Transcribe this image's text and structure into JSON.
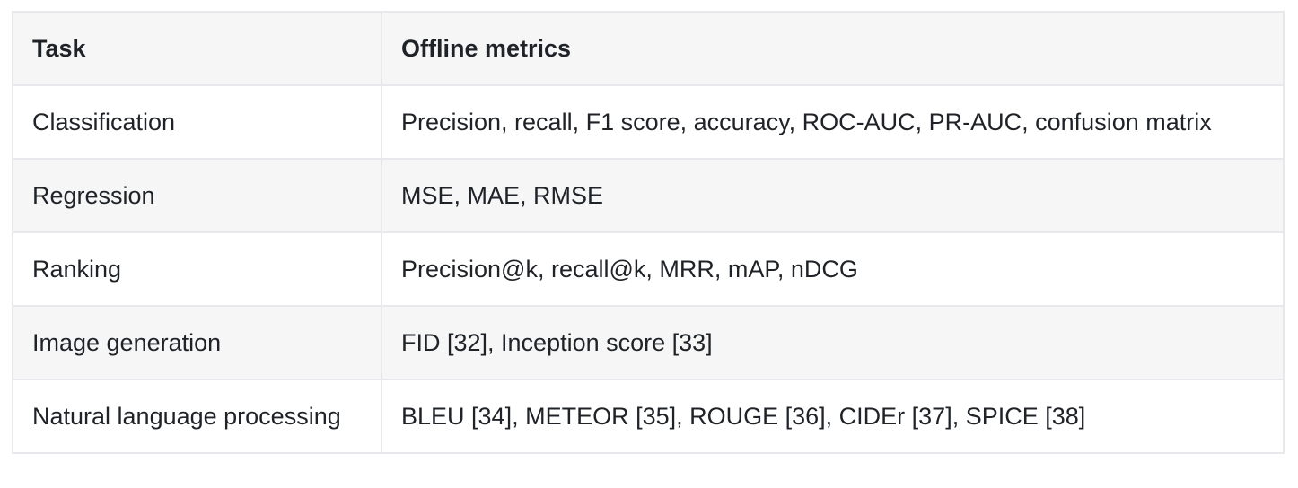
{
  "table": {
    "headers": [
      "Task",
      "Offline metrics"
    ],
    "rows": [
      [
        "Classification",
        "Precision, recall, F1 score, accuracy, ROC-AUC, PR-AUC, confusion matrix"
      ],
      [
        "Regression",
        "MSE, MAE, RMSE"
      ],
      [
        "Ranking",
        "Precision@k, recall@k, MRR, mAP, nDCG"
      ],
      [
        "Image generation",
        "FID [32], Inception score [33]"
      ],
      [
        "Natural language processing",
        "BLEU [34], METEOR [35], ROUGE [36], CIDEr [37], SPICE [38]"
      ]
    ]
  }
}
